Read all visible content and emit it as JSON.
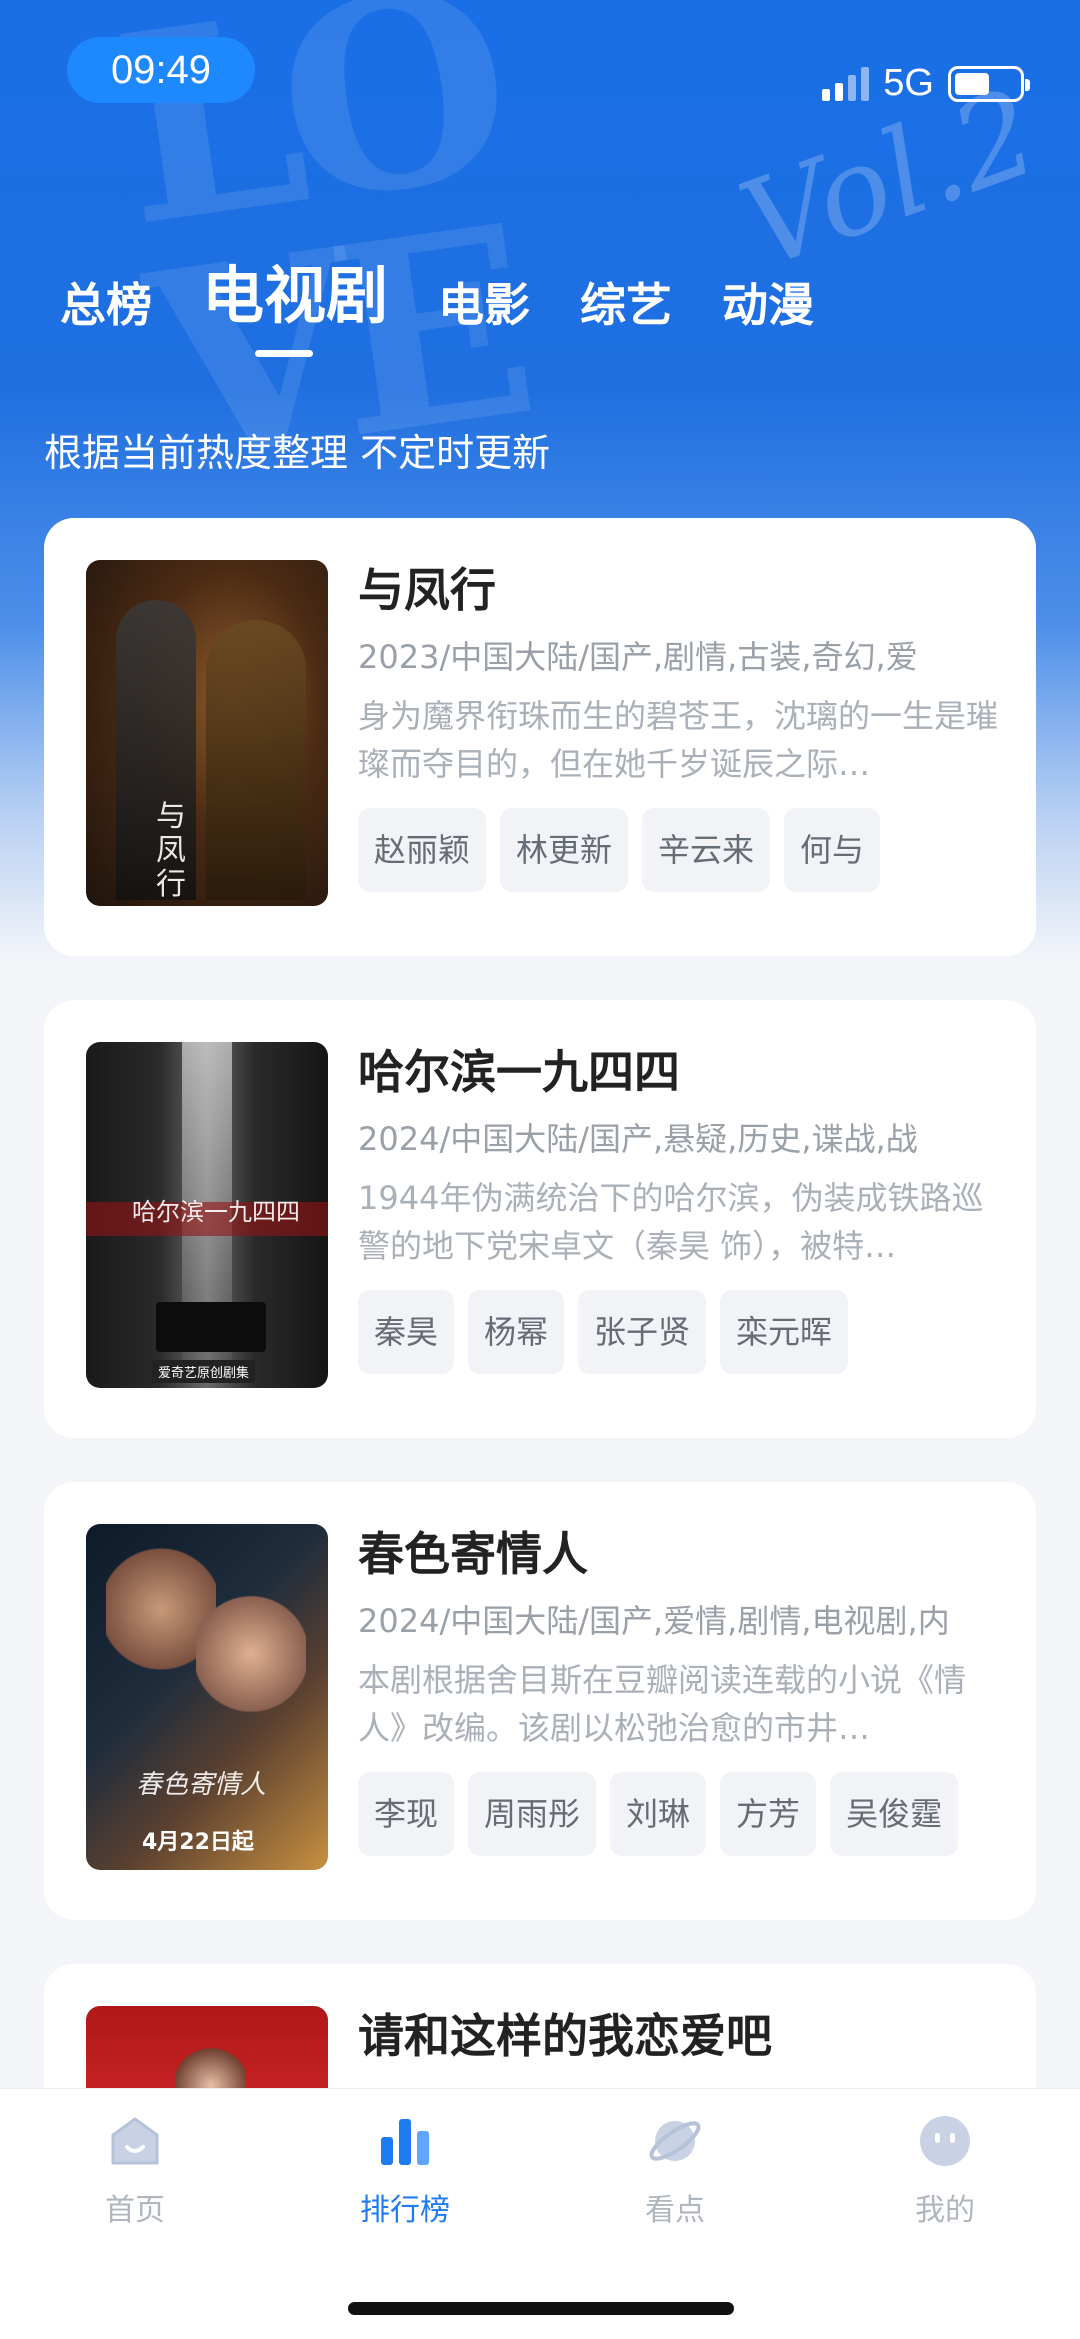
{
  "status_bar": {
    "time": "09:49",
    "network": "5G",
    "battery_level": 0.55
  },
  "tabs": [
    {
      "label": "总榜",
      "active": false
    },
    {
      "label": "电视剧",
      "active": true
    },
    {
      "label": "电影",
      "active": false
    },
    {
      "label": "综艺",
      "active": false
    },
    {
      "label": "动漫",
      "active": false
    }
  ],
  "subtitle": "根据当前热度整理 不定时更新",
  "shows": [
    {
      "title": "与凤行",
      "meta": "2023/中国大陆/国产,剧情,古装,奇幻,爱",
      "description": "身为魔界衔珠而生的碧苍王，沈璃的一生是璀璨而夺目的，但在她千岁诞辰之际…",
      "cast": [
        "赵丽颖",
        "林更新",
        "辛云来",
        "何与"
      ],
      "poster_text": "与凤行"
    },
    {
      "title": "哈尔滨一九四四",
      "meta": "2024/中国大陆/国产,悬疑,历史,谍战,战",
      "description": "1944年伪满统治下的哈尔滨，伪装成铁路巡警的地下党宋卓文（秦昊 饰），被特…",
      "cast": [
        "秦昊",
        "杨幂",
        "张子贤",
        "栾元晖"
      ],
      "poster_text": "哈尔滨一九四四",
      "poster_badge": "爱奇艺原创剧集"
    },
    {
      "title": "春色寄情人",
      "meta": "2024/中国大陆/国产,爱情,剧情,电视剧,内",
      "description": "本剧根据舍目斯在豆瓣阅读连载的小说《情人》改编。该剧以松弛治愈的市井…",
      "cast": [
        "李现",
        "周雨彤",
        "刘琳",
        "方芳",
        "吴俊霆"
      ],
      "poster_text": "春色寄情人",
      "poster_date": "4月22日起"
    },
    {
      "title": "请和这样的我恋爱吧"
    }
  ],
  "bottom_nav": [
    {
      "label": "首页",
      "icon": "home-icon",
      "active": false
    },
    {
      "label": "排行榜",
      "icon": "chart-icon",
      "active": true
    },
    {
      "label": "看点",
      "icon": "planet-icon",
      "active": false
    },
    {
      "label": "我的",
      "icon": "profile-face-icon",
      "active": false
    }
  ],
  "colors": {
    "accent": "#1f7cf0",
    "hero_top": "#1a6fe6",
    "background": "#f3f5f9"
  }
}
